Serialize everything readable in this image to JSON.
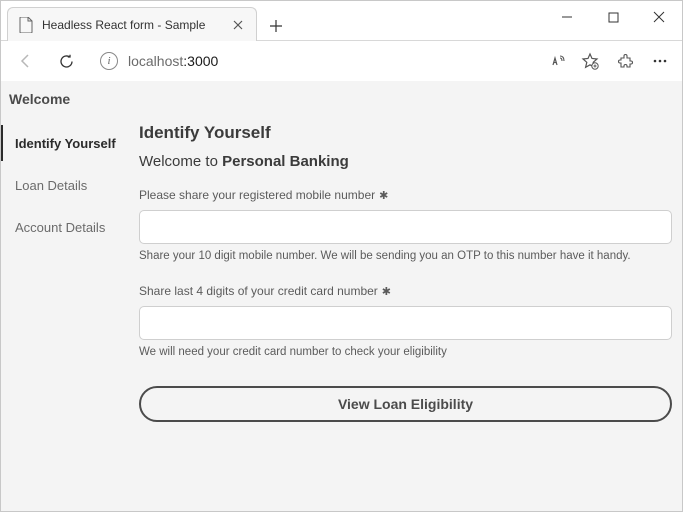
{
  "browser": {
    "tab_title": "Headless React form - Sample",
    "url_host": "localhost",
    "url_port": ":3000"
  },
  "page": {
    "welcome": "Welcome",
    "sidebar": {
      "items": [
        {
          "label": "Identify Yourself",
          "active": true
        },
        {
          "label": "Loan Details",
          "active": false
        },
        {
          "label": "Account Details",
          "active": false
        }
      ]
    },
    "main": {
      "heading": "Identify Yourself",
      "subwelcome_prefix": "Welcome to ",
      "subwelcome_bold": "Personal Banking",
      "fields": [
        {
          "label": "Please share your registered mobile number",
          "required": true,
          "value": "",
          "help": "Share your 10 digit mobile number. We will be sending you an OTP to this number have it handy."
        },
        {
          "label": "Share last 4 digits of your credit card number",
          "required": true,
          "value": "",
          "help": "We will need your credit card number to check your eligibility"
        }
      ],
      "cta": "View Loan Eligibility"
    }
  }
}
